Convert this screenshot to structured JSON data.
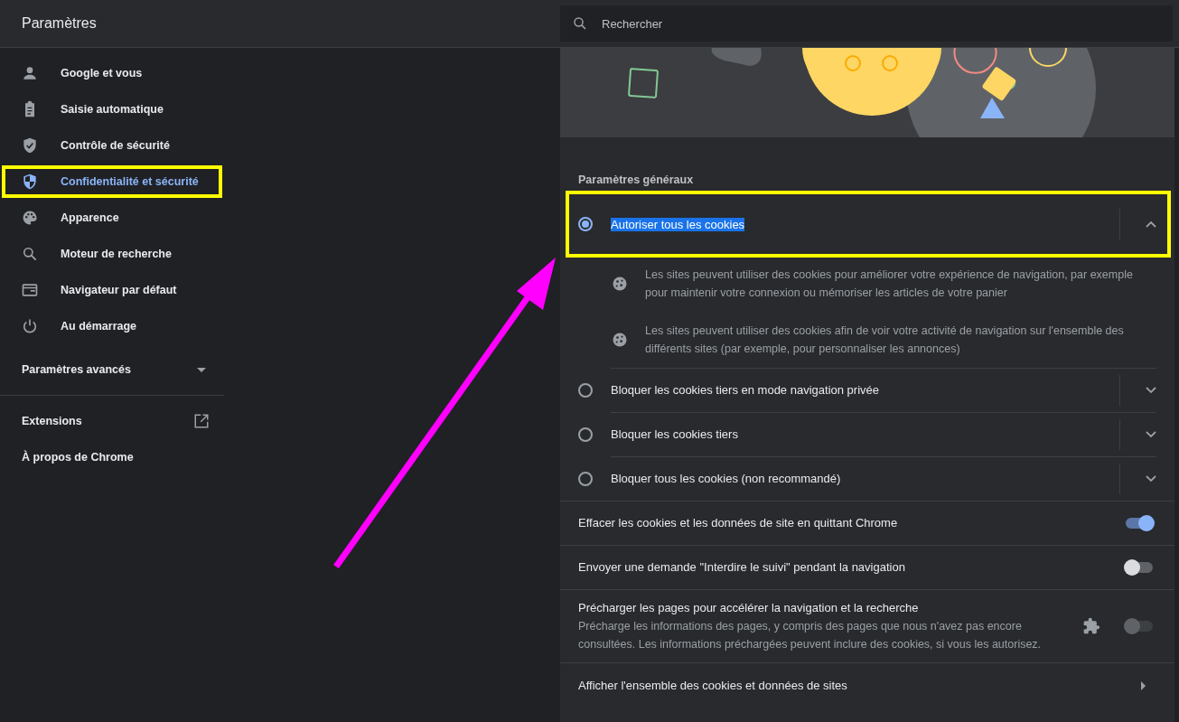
{
  "header": {
    "title": "Paramètres"
  },
  "search": {
    "placeholder": "Rechercher"
  },
  "sidebar": {
    "items": [
      {
        "label": "Google et vous",
        "kind": "person",
        "selected": false,
        "highlighted": false
      },
      {
        "label": "Saisie automatique",
        "kind": "clipboard",
        "selected": false,
        "highlighted": false
      },
      {
        "label": "Contrôle de sécurité",
        "kind": "check",
        "selected": false,
        "highlighted": false
      },
      {
        "label": "Confidentialité et sécurité",
        "kind": "privacy",
        "selected": true,
        "highlighted": true
      },
      {
        "label": "Apparence",
        "kind": "appearance",
        "selected": false,
        "highlighted": false
      },
      {
        "label": "Moteur de recherche",
        "kind": "search",
        "selected": false,
        "highlighted": false
      },
      {
        "label": "Navigateur par défaut",
        "kind": "browser",
        "selected": false,
        "highlighted": false
      },
      {
        "label": "Au démarrage",
        "kind": "startup",
        "selected": false,
        "highlighted": false
      }
    ],
    "advanced": {
      "label": "Paramètres avancés",
      "expanded": false
    },
    "links": [
      {
        "label": "Extensions",
        "external": true
      },
      {
        "label": "À propos de Chrome",
        "external": false
      }
    ]
  },
  "cookies": {
    "section_title": "Paramètres généraux",
    "options": [
      {
        "label": "Autoriser tous les cookies",
        "selected": true,
        "expanded": true,
        "highlighted": true,
        "text_selected": true,
        "details": [
          "Les sites peuvent utiliser des cookies pour améliorer votre expérience de navigation, par exemple pour maintenir votre connexion ou mémoriser les articles de votre panier",
          "Les sites peuvent utiliser des cookies afin de voir votre activité de navigation sur l'ensemble des différents sites (par exemple, pour personnaliser les annonces)"
        ]
      },
      {
        "label": "Bloquer les cookies tiers en mode navigation privée",
        "selected": false,
        "expanded": false,
        "highlighted": false,
        "text_selected": false
      },
      {
        "label": "Bloquer les cookies tiers",
        "selected": false,
        "expanded": false,
        "highlighted": false,
        "text_selected": false
      },
      {
        "label": "Bloquer tous les cookies (non recommandé)",
        "selected": false,
        "expanded": false,
        "highlighted": false,
        "text_selected": false
      }
    ],
    "settings": [
      {
        "kind": "toggle",
        "label": "Effacer les cookies et les données de site en quittant Chrome",
        "on": true,
        "disabled": false,
        "managed": false
      },
      {
        "kind": "toggle",
        "label": "Envoyer une demande \"Interdire le suivi\" pendant la navigation",
        "on": false,
        "disabled": false,
        "managed": false
      },
      {
        "kind": "toggle",
        "label": "Précharger les pages pour accélérer la navigation et la recherche",
        "description": "Précharge les informations des pages, y compris des pages que nous n'avez pas encore consultées. Les informations préchargées peuvent inclure des cookies, si vous les autorisez.",
        "on": false,
        "disabled": true,
        "managed": true
      },
      {
        "kind": "link",
        "label": "Afficher l'ensemble des cookies et données de sites"
      }
    ]
  }
}
